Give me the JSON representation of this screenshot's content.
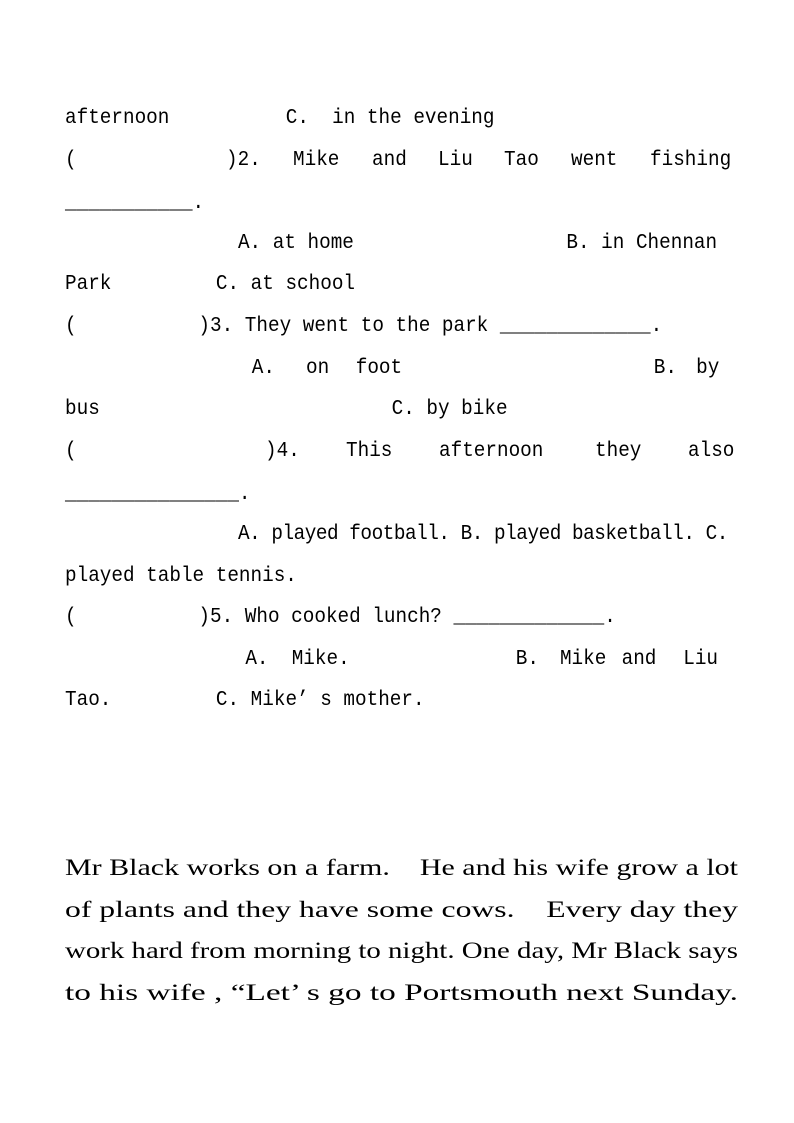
{
  "questions": {
    "q1_tail": {
      "continuation": "afternoon",
      "option_c": "C.  in the evening"
    },
    "q2": {
      "bracket_open": "(",
      "bracket_close": ")2.",
      "words": [
        "Mike",
        "and",
        "Liu",
        "Tao",
        "went",
        "fishing"
      ],
      "blank": "___________.",
      "option_a": "A. at home",
      "option_b": "B. in Chennan",
      "option_b_cont": "Park",
      "option_c": "C. at school"
    },
    "q3": {
      "bracket_open": "(",
      "bracket_close": ")3.",
      "stem": "They went to the park _____________.",
      "option_a_label": "A.",
      "option_a_words": [
        "on",
        "foot"
      ],
      "option_b_label": "B.",
      "option_b_word": "by",
      "option_b_cont": "bus",
      "option_c": "C. by bike"
    },
    "q4": {
      "bracket_open": "(",
      "bracket_close": ")4.",
      "words": [
        "This",
        "afternoon",
        "they",
        "also"
      ],
      "blank": "_______________.",
      "options_line": "A. played football. B. played basketball. C.",
      "options_cont": "played table tennis."
    },
    "q5": {
      "bracket_open": "(",
      "bracket_close": ")5.",
      "stem": "Who cooked lunch? _____________.",
      "option_a": "A.  Mike.",
      "option_b_words": [
        "B.",
        "Mike",
        "and",
        "Liu"
      ],
      "option_b_cont": "Tao.",
      "option_c": "C. Mike’ s mother."
    }
  },
  "passage": {
    "lines": [
      "Mr Black works on a farm.    He and his wife grow a lot",
      "of plants and they have some cows.    Every day they",
      "work hard from morning to night. One day, Mr Black says",
      "to his wife , “Let’ s go to Portsmouth next Sunday."
    ]
  }
}
